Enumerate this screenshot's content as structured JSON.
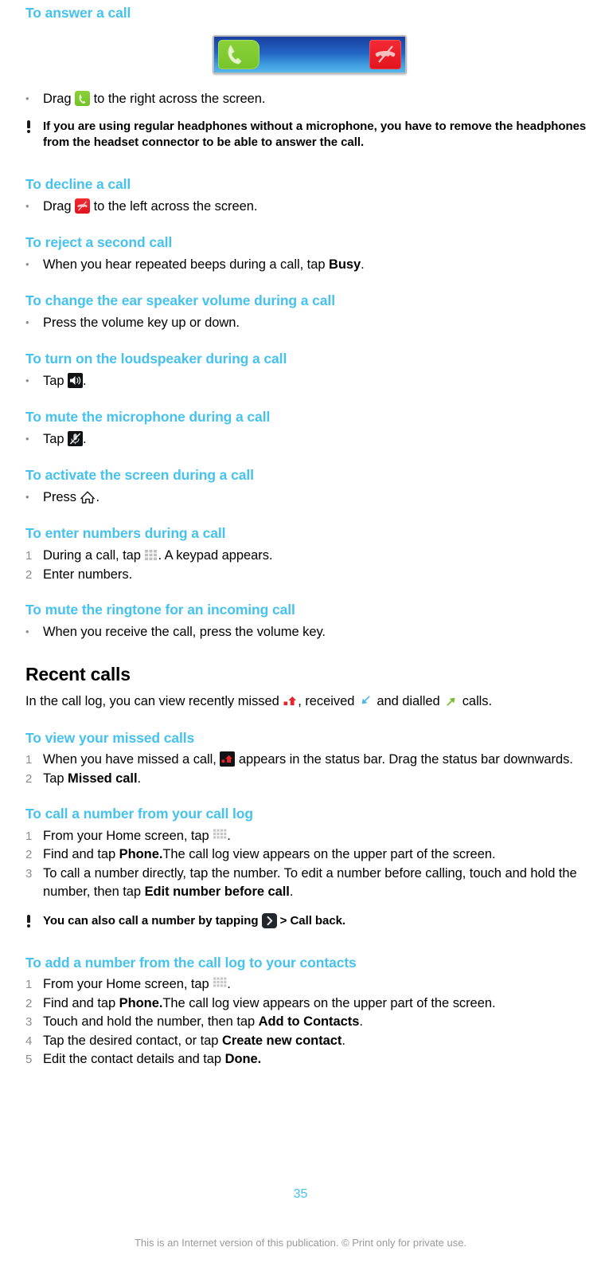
{
  "document": {
    "accent_color": "#45c2ee",
    "page_number": "35",
    "footnote": "This is an Internet version of this publication. © Print only for private use."
  },
  "sections": [
    {
      "id": "answer-call",
      "heading": "To answer a call",
      "figure": {
        "name": "incoming-call-slider",
        "answer_icon": "phone-answer-icon",
        "decline_icon": "phone-decline-icon"
      },
      "steps": [
        {
          "marker": "•",
          "parts": [
            {
              "t": "text",
              "v": "Drag "
            },
            {
              "t": "icon",
              "v": "phone-answer-icon"
            },
            {
              "t": "text",
              "v": " to the right across the screen."
            }
          ]
        }
      ],
      "tip": {
        "icon": "exclamation-icon",
        "text": "If you are using regular headphones without a microphone, you have to remove the headphones from the headset connector to be able to answer the call."
      }
    },
    {
      "id": "decline-call",
      "heading": "To decline a call",
      "steps": [
        {
          "marker": "•",
          "parts": [
            {
              "t": "text",
              "v": "Drag "
            },
            {
              "t": "icon",
              "v": "phone-decline-icon"
            },
            {
              "t": "text",
              "v": " to the left across the screen."
            }
          ]
        }
      ]
    },
    {
      "id": "reject-second-call",
      "heading": "To reject a second call",
      "steps": [
        {
          "marker": "•",
          "parts": [
            {
              "t": "text",
              "v": "When you hear repeated beeps during a call, tap "
            },
            {
              "t": "bold",
              "v": "Busy"
            },
            {
              "t": "text",
              "v": "."
            }
          ]
        }
      ]
    },
    {
      "id": "change-volume",
      "heading": "To change the ear speaker volume during a call",
      "steps": [
        {
          "marker": "•",
          "parts": [
            {
              "t": "text",
              "v": "Press the volume key up or down."
            }
          ]
        }
      ]
    },
    {
      "id": "loudspeaker",
      "heading": "To turn on the loudspeaker during a call",
      "steps": [
        {
          "marker": "•",
          "parts": [
            {
              "t": "text",
              "v": "Tap "
            },
            {
              "t": "icon",
              "v": "speaker-icon"
            },
            {
              "t": "text",
              "v": "."
            }
          ]
        }
      ]
    },
    {
      "id": "mute-microphone",
      "heading": "To mute the microphone during a call",
      "steps": [
        {
          "marker": "•",
          "parts": [
            {
              "t": "text",
              "v": "Tap "
            },
            {
              "t": "icon",
              "v": "microphone-mute-icon"
            },
            {
              "t": "text",
              "v": "."
            }
          ]
        }
      ]
    },
    {
      "id": "activate-screen",
      "heading": "To activate the screen during a call",
      "steps": [
        {
          "marker": "•",
          "parts": [
            {
              "t": "text",
              "v": "Press "
            },
            {
              "t": "icon",
              "v": "home-icon"
            },
            {
              "t": "text",
              "v": "."
            }
          ]
        }
      ]
    },
    {
      "id": "enter-numbers",
      "heading": "To enter numbers during a call",
      "steps": [
        {
          "marker": "1",
          "parts": [
            {
              "t": "text",
              "v": "During a call, tap "
            },
            {
              "t": "icon",
              "v": "keypad-icon"
            },
            {
              "t": "text",
              "v": ". A keypad appears."
            }
          ]
        },
        {
          "marker": "2",
          "parts": [
            {
              "t": "text",
              "v": "Enter numbers."
            }
          ]
        }
      ]
    },
    {
      "id": "mute-ringtone",
      "heading": "To mute the ringtone for an incoming call",
      "steps": [
        {
          "marker": "•",
          "parts": [
            {
              "t": "text",
              "v": "When you receive the call, press the volume key."
            }
          ]
        }
      ]
    }
  ],
  "recent_calls": {
    "heading": "Recent calls",
    "intro_parts": [
      {
        "t": "text",
        "v": "In the call log, you can view recently missed "
      },
      {
        "t": "icon",
        "v": "missed-call-icon"
      },
      {
        "t": "text",
        "v": ", received "
      },
      {
        "t": "icon",
        "v": "received-call-icon"
      },
      {
        "t": "text",
        "v": " and dialled "
      },
      {
        "t": "icon",
        "v": "dialled-call-icon"
      },
      {
        "t": "text",
        "v": " calls."
      }
    ],
    "subsections": [
      {
        "id": "view-missed-calls",
        "heading": "To view your missed calls",
        "steps": [
          {
            "marker": "1",
            "parts": [
              {
                "t": "text",
                "v": "When you have missed a call, "
              },
              {
                "t": "icon",
                "v": "missed-call-status-icon"
              },
              {
                "t": "text",
                "v": " appears in the status bar. Drag the status bar downwards."
              }
            ]
          },
          {
            "marker": "2",
            "parts": [
              {
                "t": "text",
                "v": "Tap "
              },
              {
                "t": "bold",
                "v": "Missed call"
              },
              {
                "t": "text",
                "v": "."
              }
            ]
          }
        ]
      },
      {
        "id": "call-number-from-log",
        "heading": "To call a number from your call log",
        "steps": [
          {
            "marker": "1",
            "parts": [
              {
                "t": "text",
                "v": "From your Home screen, tap "
              },
              {
                "t": "icon",
                "v": "app-grid-icon"
              },
              {
                "t": "text",
                "v": "."
              }
            ]
          },
          {
            "marker": "2",
            "parts": [
              {
                "t": "text",
                "v": "Find and tap "
              },
              {
                "t": "bold",
                "v": "Phone."
              },
              {
                "t": "text",
                "v": "The call log view appears on the upper part of the screen."
              }
            ]
          },
          {
            "marker": "3",
            "parts": [
              {
                "t": "text",
                "v": "To call a number directly, tap the number. To edit a number before calling, touch and hold the number, then tap "
              },
              {
                "t": "bold",
                "v": "Edit number before call"
              },
              {
                "t": "text",
                "v": "."
              }
            ]
          }
        ],
        "tip": {
          "icon": "exclamation-icon",
          "parts": [
            {
              "t": "text",
              "v": "You can also call a number by tapping "
            },
            {
              "t": "icon",
              "v": "chevron-right-icon"
            },
            {
              "t": "text",
              "v": " > "
            },
            {
              "t": "bold",
              "v": "Call back"
            },
            {
              "t": "text",
              "v": "."
            }
          ]
        }
      },
      {
        "id": "add-number-to-contacts",
        "heading": "To add a number from the call log to your contacts",
        "steps": [
          {
            "marker": "1",
            "parts": [
              {
                "t": "text",
                "v": "From your Home screen, tap "
              },
              {
                "t": "icon",
                "v": "app-grid-icon"
              },
              {
                "t": "text",
                "v": "."
              }
            ]
          },
          {
            "marker": "2",
            "parts": [
              {
                "t": "text",
                "v": "Find and tap "
              },
              {
                "t": "bold",
                "v": "Phone."
              },
              {
                "t": "text",
                "v": "The call log view appears on the upper part of the screen."
              }
            ]
          },
          {
            "marker": "3",
            "parts": [
              {
                "t": "text",
                "v": "Touch and hold the number, then tap "
              },
              {
                "t": "bold",
                "v": "Add to Contacts"
              },
              {
                "t": "text",
                "v": "."
              }
            ]
          },
          {
            "marker": "4",
            "parts": [
              {
                "t": "text",
                "v": "Tap the desired contact, or tap "
              },
              {
                "t": "bold",
                "v": "Create new contact"
              },
              {
                "t": "text",
                "v": "."
              }
            ]
          },
          {
            "marker": "5",
            "parts": [
              {
                "t": "text",
                "v": "Edit the contact details and tap "
              },
              {
                "t": "bold",
                "v": "Done."
              }
            ]
          }
        ]
      }
    ]
  }
}
